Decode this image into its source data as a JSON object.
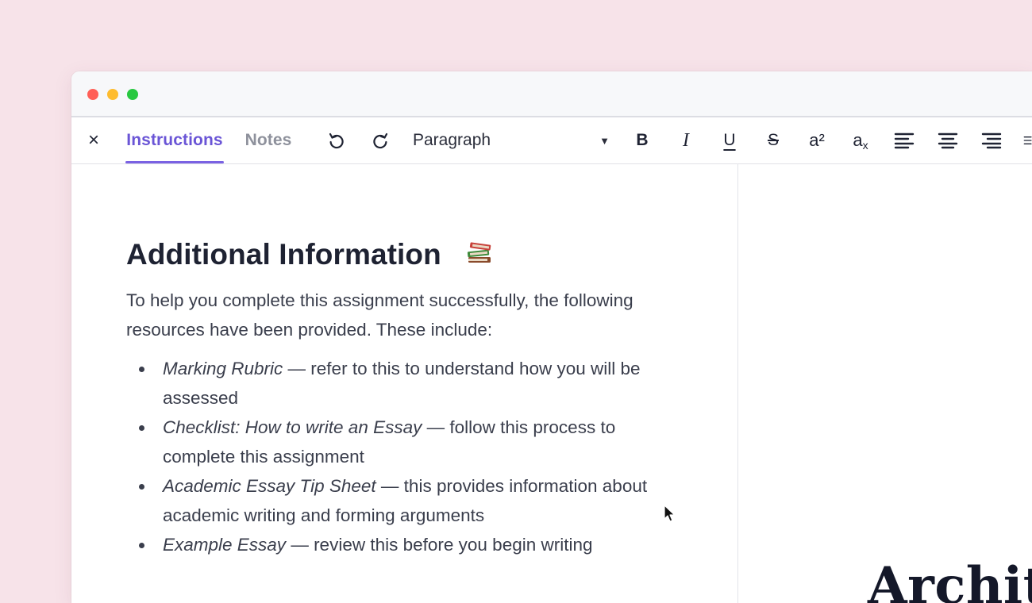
{
  "window": {
    "traffic_lights": [
      "#ff5f57",
      "#febc2e",
      "#28c840"
    ]
  },
  "toolbar": {
    "close_icon": "×",
    "tabs": [
      {
        "label": "Instructions",
        "active": true
      },
      {
        "label": "Notes",
        "active": false
      }
    ],
    "undo_icon": "undo-icon",
    "redo_icon": "redo-icon",
    "block_style": "Paragraph",
    "bold_label": "B",
    "italic_label": "I",
    "underline_label": "U",
    "strike_label": "S",
    "superscript_label": "a²",
    "subscript_base": "a",
    "subscript_sub": "x",
    "accent_color": "#6a55d6"
  },
  "document": {
    "heading": "Additional Information",
    "heading_emoji": "books-icon",
    "intro": "To help you complete this assignment successfully, the following resources have been provided. These include:",
    "items": [
      {
        "title": "Marking Rubric",
        "desc": " — refer to this to understand how you will be assessed"
      },
      {
        "title": "Checklist: How to write an Essay",
        "desc": " — follow this process to complete this assignment"
      },
      {
        "title": "Academic Essay Tip Sheet",
        "desc": " — this provides information about academic writing and forming arguments"
      },
      {
        "title": "Example Essay",
        "desc": " — review this before you begin writing"
      }
    ]
  },
  "preview": {
    "cover_text": "Archite"
  }
}
